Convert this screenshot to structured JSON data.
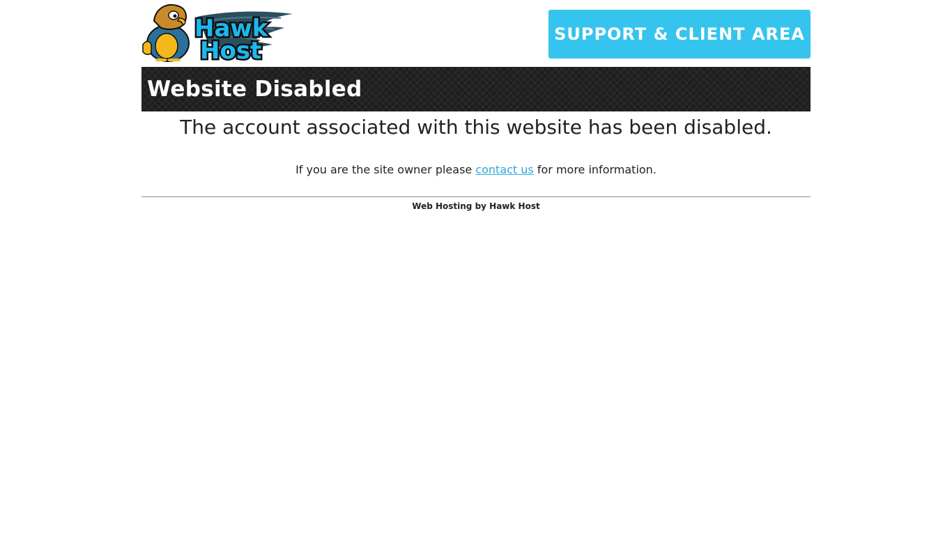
{
  "header": {
    "logo_text": [
      "Hawk",
      "Host"
    ],
    "logo_alt": "Hawk Host",
    "support_button_label": "SUPPORT & CLIENT AREA"
  },
  "page": {
    "title": "Website Disabled",
    "headline": "The account associated with this website has been disabled.",
    "info_prefix": "If you are the site owner please ",
    "info_link": "contact us",
    "info_suffix": " for more information."
  },
  "footer": {
    "text": "Web Hosting by Hawk Host"
  },
  "colors": {
    "accent": "#35c4ee",
    "link": "#2aa8dd",
    "title_bar": "#1e1e1e",
    "logo_text": "#1bb8ee",
    "logo_outline": "#101010",
    "hawk_body": "#c98a2a",
    "hawk_belly": "#f4b81c",
    "wing": "#2b4f5f"
  }
}
